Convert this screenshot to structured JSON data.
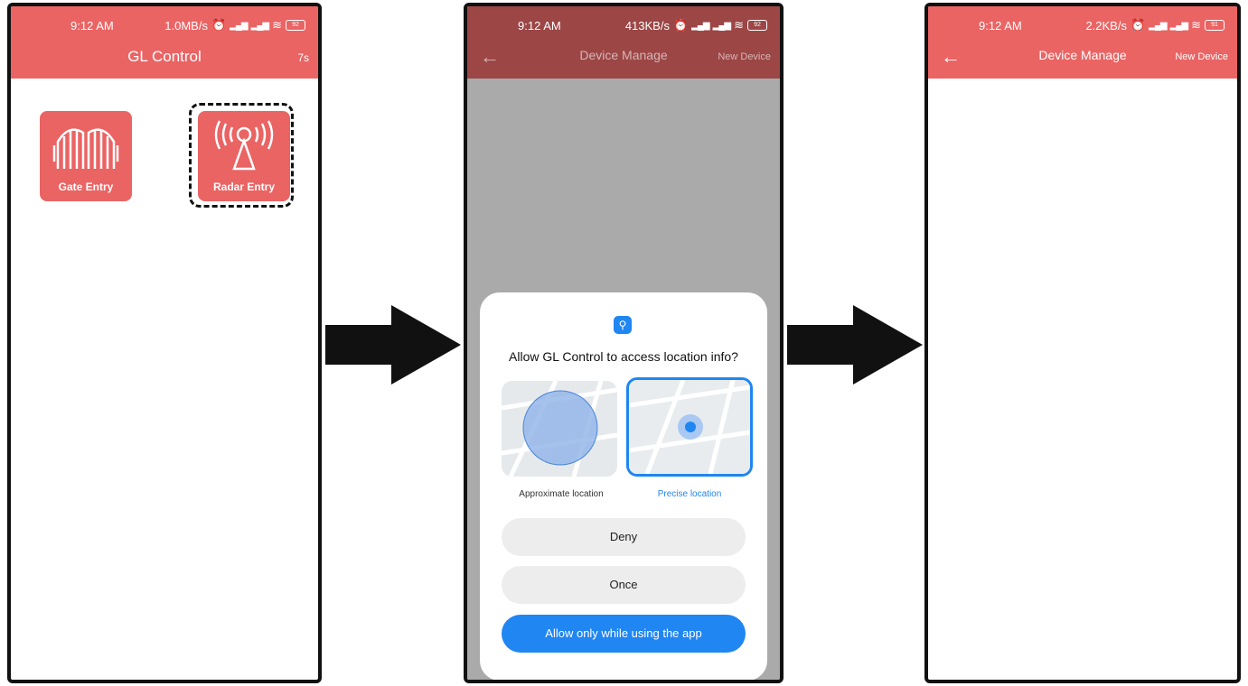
{
  "phone1": {
    "status": {
      "time": "9:12 AM",
      "speed": "1.0MB/s",
      "battery": "92"
    },
    "title": "GL Control",
    "timer": "7s",
    "tiles": [
      {
        "label": "Gate Entry",
        "icon": "gate-icon"
      },
      {
        "label": "Radar Entry",
        "icon": "radar-icon"
      }
    ]
  },
  "phone2": {
    "status": {
      "time": "9:12 AM",
      "speed": "413KB/s",
      "battery": "92"
    },
    "back_icon": "arrow-left-icon",
    "title": "Device Manage",
    "right_link": "New Device",
    "dialog": {
      "icon": "location-pin-icon",
      "question": "Allow GL Control to access location info?",
      "approximate_label": "Approximate location",
      "precise_label": "Precise location",
      "selected": "Precise location",
      "deny": "Deny",
      "once": "Once",
      "allow": "Allow only while using the app"
    }
  },
  "phone3": {
    "status": {
      "time": "9:12 AM",
      "speed": "2.2KB/s",
      "battery": "91"
    },
    "back_icon": "arrow-left-icon",
    "title": "Device Manage",
    "right_link": "New Device"
  },
  "colors": {
    "header": "#ea6464",
    "accent": "#1f86f2"
  }
}
